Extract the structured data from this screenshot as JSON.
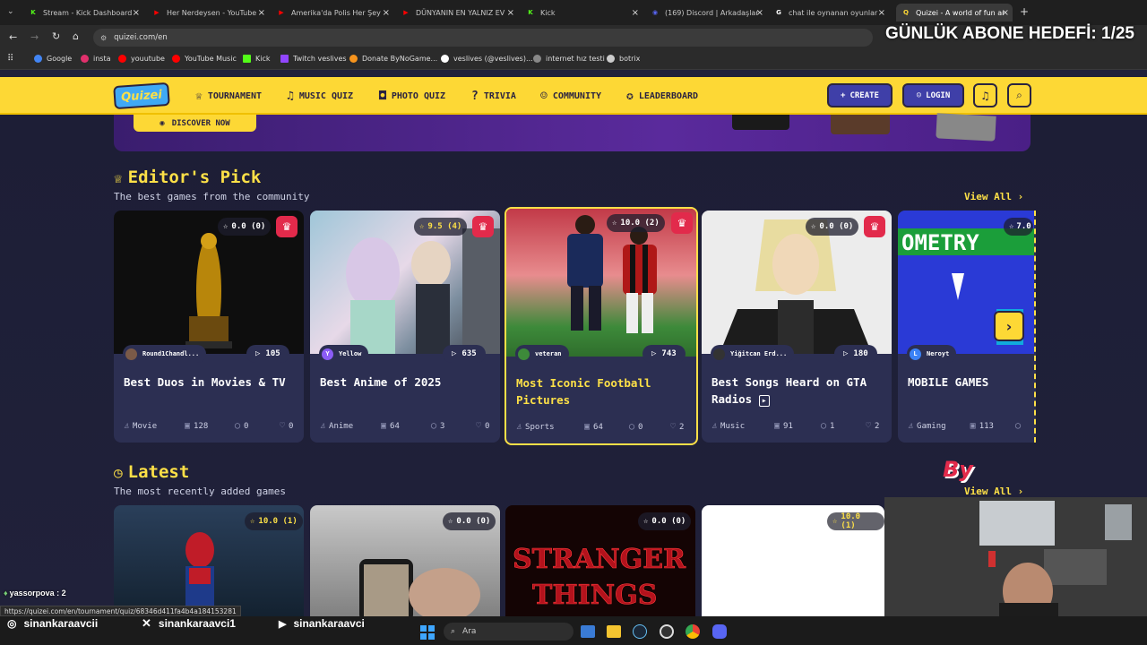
{
  "browser": {
    "tabs": [
      {
        "title": "Stream - Kick Dashboard",
        "fav": "K",
        "color": "#53fc18"
      },
      {
        "title": "Her Nerdeysen - YouTube",
        "fav": "▶",
        "color": "#ff0000"
      },
      {
        "title": "Amerika'da Polis Her Şey",
        "fav": "▶",
        "color": "#ff0000"
      },
      {
        "title": "DÜNYANIN EN YALNIZ EV",
        "fav": "▶",
        "color": "#ff0000"
      },
      {
        "title": "Kick",
        "fav": "K",
        "color": "#53fc18"
      },
      {
        "title": "(169) Discord | Arkadaşlar",
        "fav": "◉",
        "color": "#5865f2"
      },
      {
        "title": "chat ile oynanan oyunlar",
        "fav": "G",
        "color": "#ffffff"
      },
      {
        "title": "Quizei - A world of fun ar",
        "fav": "Q",
        "color": "#fdd835"
      }
    ],
    "url": "quizei.com/en",
    "bookmarks": [
      {
        "label": "Google",
        "color": "#4285f4"
      },
      {
        "label": "insta",
        "color": "#e1306c"
      },
      {
        "label": "youutube",
        "color": "#ff0000"
      },
      {
        "label": "YouTube Music",
        "color": "#ff0000"
      },
      {
        "label": "Kick",
        "color": "#53fc18"
      },
      {
        "label": "Twitch veslives",
        "color": "#9146ff"
      },
      {
        "label": "Donate ByNoGame...",
        "color": "#f7941d"
      },
      {
        "label": "veslives (@veslives)...",
        "color": "#ffffff"
      },
      {
        "label": "internet hız testi",
        "color": "#888888"
      },
      {
        "label": "botrix",
        "color": "#cccccc"
      }
    ],
    "status_url": "https://quizei.com/en/tournament/quiz/68346d411fa4b4a184153281"
  },
  "overlay": {
    "goal_text": "GÜNLÜK ABONE HEDEFİ: 1/25",
    "chat_line": "yassorpova : 2",
    "socials": [
      "sinankaraavcii",
      "sinankaraavci1",
      "sinankaraavci"
    ]
  },
  "nav": {
    "logo": "Quizei",
    "items": [
      "TOURNAMENT",
      "MUSIC QUIZ",
      "PHOTO QUIZ",
      "TRIVIA",
      "COMMUNITY",
      "LEADERBOARD"
    ],
    "create": "CREATE",
    "login": "LOGIN"
  },
  "banner": {
    "button": "DISCOVER NOW"
  },
  "editors_pick": {
    "title": "Editor's Pick",
    "subtitle": "The best games from the community",
    "view_all": "View All",
    "cards": [
      {
        "rating": "0.0 (0)",
        "author": "Round1Chandl...",
        "plays": "105",
        "title": "Best Duos in Movies & TV",
        "category": "Movie",
        "questions": "128",
        "comments": "0",
        "likes": "0"
      },
      {
        "rating": "9.5 (4)",
        "author": "Yellow",
        "plays": "635",
        "title": "Best Anime of 2025",
        "category": "Anime",
        "questions": "64",
        "comments": "3",
        "likes": "0"
      },
      {
        "rating": "10.0 (2)",
        "author": "veteran",
        "plays": "743",
        "title": "Most Iconic Football Pictures",
        "category": "Sports",
        "questions": "64",
        "comments": "0",
        "likes": "2"
      },
      {
        "rating": "0.0 (0)",
        "author": "Yiğitcan Erd...",
        "plays": "180",
        "title": "Best Songs Heard on GTA Radios",
        "category": "Music",
        "questions": "91",
        "comments": "1",
        "likes": "2"
      },
      {
        "rating": "7.0",
        "author": "Neroyt",
        "plays": "",
        "title": "MOBILE GAMES",
        "category": "Gaming",
        "questions": "113",
        "comments": "",
        "likes": ""
      }
    ]
  },
  "latest": {
    "title": "Latest",
    "subtitle": "The most recently added games",
    "view_all": "View All",
    "cards": [
      {
        "rating": "10.0 (1)"
      },
      {
        "rating": "0.0 (0)"
      },
      {
        "rating": "0.0 (0)"
      },
      {
        "rating": "10.0 (1)"
      }
    ]
  },
  "taskbar": {
    "search_placeholder": "Ara"
  }
}
